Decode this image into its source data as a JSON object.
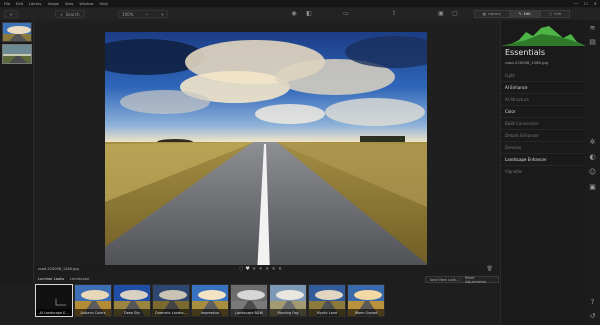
{
  "menubar": {
    "items": [
      "File",
      "Edit",
      "Library",
      "Image",
      "View",
      "Window",
      "Help"
    ],
    "window_controls": [
      "—",
      "☐",
      "✕"
    ]
  },
  "toolbar": {
    "add_label": "+",
    "zoom_label": "100%",
    "zoom_minus": "−",
    "zoom_plus": "+",
    "search_label": "Search",
    "tabs": [
      {
        "label": "Library",
        "active": false
      },
      {
        "label": "Edit",
        "active": true
      },
      {
        "label": "Info",
        "active": false
      }
    ]
  },
  "photo": {
    "filename": "road-220058_1280.jpg",
    "rating_stars": 0
  },
  "right_panel": {
    "title": "Essentials",
    "filename": "road-220058_1280.jpg",
    "items": [
      {
        "label": "Light",
        "bright": false
      },
      {
        "label": "AI Enhance",
        "bright": true
      },
      {
        "label": "AI Structure",
        "bright": false
      },
      {
        "label": "Color",
        "bright": true
      },
      {
        "label": "B&W Conversion",
        "bright": false
      },
      {
        "label": "Details Enhancer",
        "bright": false
      },
      {
        "label": "Denoise",
        "bright": false
      },
      {
        "label": "Landscape Enhancer",
        "bright": true
      },
      {
        "label": "Vignette",
        "bright": false
      }
    ]
  },
  "looks_bar": {
    "tabs": [
      "Luminar Looks",
      "Landscape"
    ],
    "save_label": "Save New Look...",
    "reset_label": "Reset Adjustments"
  },
  "looks": [
    {
      "label": "AI Landscape E..."
    },
    {
      "label": "Autumn Colors"
    },
    {
      "label": "Deep Sky"
    },
    {
      "label": "Dramatic Landsc..."
    },
    {
      "label": "Impressive"
    },
    {
      "label": "Landscape B&W"
    },
    {
      "label": "Morning Fog"
    },
    {
      "label": "Mystic Land"
    },
    {
      "label": "Warm Sunset"
    }
  ],
  "colors": {
    "accent_green": "#4fb446",
    "bg": "#1e1e1e"
  }
}
